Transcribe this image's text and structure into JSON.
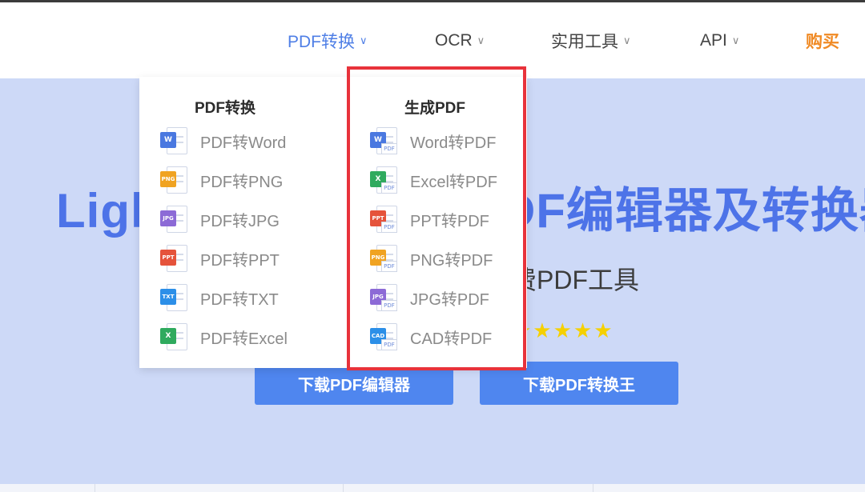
{
  "nav": {
    "items": [
      {
        "label": "PDF转换",
        "icon": "chevron-down-icon"
      },
      {
        "label": "OCR",
        "icon": "chevron-down-icon"
      },
      {
        "label": "实用工具",
        "icon": "chevron-down-icon"
      },
      {
        "label": "API",
        "icon": "chevron-down-icon"
      }
    ],
    "buy": "购买",
    "chevron": "∨"
  },
  "hero": {
    "title": "LightPDF - 一站式PDF编辑器及转换器",
    "subtitle": "解决所有问题的免费PDF工具",
    "stars": "★★★★★",
    "buttons": [
      "下载PDF编辑器",
      "下载PDF转换王"
    ]
  },
  "dropdown": {
    "left_title": "PDF转换",
    "left_items": [
      {
        "label": "PDF转Word",
        "icon": "word-icon",
        "tag": "W",
        "color": "#4a78e0"
      },
      {
        "label": "PDF转PNG",
        "icon": "png-icon",
        "tag": "PNG",
        "color": "#f0a322"
      },
      {
        "label": "PDF转JPG",
        "icon": "jpg-icon",
        "tag": "JPG",
        "color": "#8c6ad6"
      },
      {
        "label": "PDF转PPT",
        "icon": "ppt-icon",
        "tag": "PPT",
        "color": "#e5533b"
      },
      {
        "label": "PDF转TXT",
        "icon": "txt-icon",
        "tag": "TXT",
        "color": "#2c8fe8"
      },
      {
        "label": "PDF转Excel",
        "icon": "excel-icon",
        "tag": "X",
        "color": "#2faa5e"
      }
    ],
    "right_title": "生成PDF",
    "right_items": [
      {
        "label": "Word转PDF",
        "icon": "word-to-pdf-icon",
        "tag": "W",
        "color": "#4a78e0"
      },
      {
        "label": "Excel转PDF",
        "icon": "excel-to-pdf-icon",
        "tag": "X",
        "color": "#2faa5e"
      },
      {
        "label": "PPT转PDF",
        "icon": "ppt-to-pdf-icon",
        "tag": "PPT",
        "color": "#e5533b"
      },
      {
        "label": "PNG转PDF",
        "icon": "png-to-pdf-icon",
        "tag": "PNG",
        "color": "#f0a322"
      },
      {
        "label": "JPG转PDF",
        "icon": "jpg-to-pdf-icon",
        "tag": "JPG",
        "color": "#8c6ad6"
      },
      {
        "label": "CAD转PDF",
        "icon": "cad-to-pdf-icon",
        "tag": "CAD",
        "color": "#2c8fe8"
      }
    ],
    "pdf_tag": "PDF"
  },
  "colors": {
    "accent": "#4f7fe6",
    "buy": "#f08a24",
    "highlight": "#e8323b"
  }
}
